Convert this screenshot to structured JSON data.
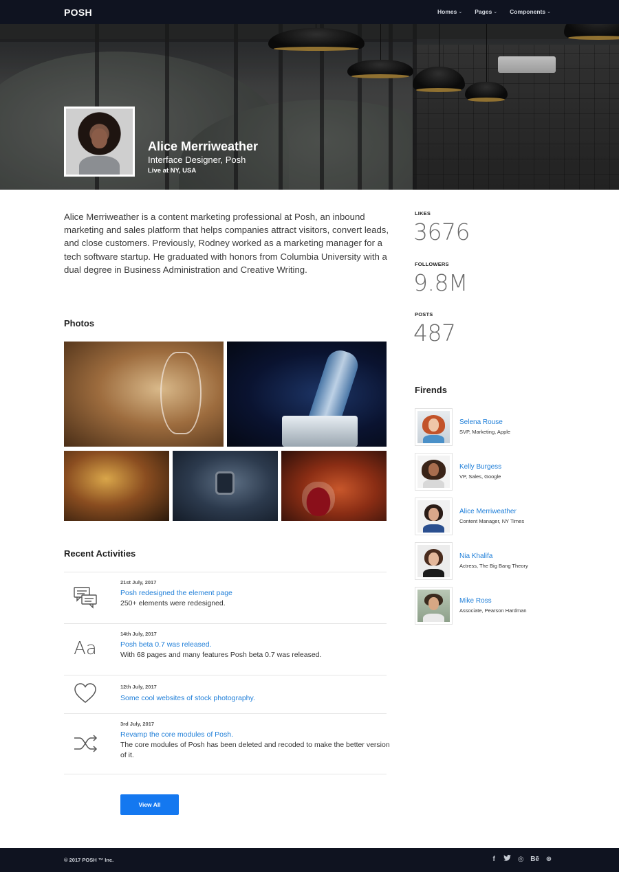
{
  "brand": {
    "logo": "POSH"
  },
  "nav": [
    {
      "label": "Homes"
    },
    {
      "label": "Pages"
    },
    {
      "label": "Components"
    }
  ],
  "profile": {
    "name": "Alice Merriweather",
    "role": "Interface Designer, Posh",
    "location": "Live at NY, USA",
    "bio": "Alice Merriweather is a content marketing professional at Posh, an inbound marketing and sales platform that helps companies attract visitors, convert leads, and close customers. Previously, Rodney worked as a marketing manager for a tech software startup. He graduated with honors from Columbia University with a dual degree in Business Administration and Creative Writing."
  },
  "sections": {
    "photos_title": "Photos",
    "activities_title": "Recent Activities",
    "friends_title": "Firends"
  },
  "stats": [
    {
      "label": "LIKES",
      "value": "3676"
    },
    {
      "label": "FOLLOWERS",
      "value": "9.8M"
    },
    {
      "label": "POSTS",
      "value": "487"
    }
  ],
  "activities": [
    {
      "icon": "chat-icon",
      "date": "21st July, 2017",
      "title": "Posh redesigned the element page",
      "desc": "250+ elements were redesigned."
    },
    {
      "icon": "typography-icon",
      "icon_text": "Aa",
      "date": "14th July, 2017",
      "title": "Posh beta 0.7 was released.",
      "desc": "With 68 pages and many features Posh beta 0.7 was released."
    },
    {
      "icon": "heart-icon",
      "date": "12th July, 2017",
      "title": "Some cool websites of stock photography.",
      "desc": ""
    },
    {
      "icon": "shuffle-icon",
      "date": "3rd July, 2017",
      "title": "Revamp the core modules of Posh.",
      "desc": "The core modules of Posh has been deleted and recoded to make the better version of it."
    }
  ],
  "view_all": "View All",
  "friends": [
    {
      "name": "Selena Rouse",
      "role": "SVP, Marketing, Apple"
    },
    {
      "name": "Kelly Burgess",
      "role": "VP, Sales, Google"
    },
    {
      "name": "Alice Merriweather",
      "role": "Content Manager, NY Times"
    },
    {
      "name": "Nia Khalifa",
      "role": "Actress, The Big Bang Theory"
    },
    {
      "name": "Mike Ross",
      "role": "Associate, Pearson Hardman"
    }
  ],
  "footer": {
    "copyright": "© 2017 POSH ™ Inc.",
    "social": [
      {
        "icon": "facebook-icon",
        "glyph": "f"
      },
      {
        "icon": "twitter-icon",
        "glyph": "🐦"
      },
      {
        "icon": "instagram-icon",
        "glyph": "◎"
      },
      {
        "icon": "behance-icon",
        "glyph": "Bē"
      },
      {
        "icon": "dribbble-icon",
        "glyph": "⊛"
      }
    ]
  },
  "colors": {
    "navbar": "#0f1320",
    "link": "#1e7ed8",
    "button": "#1478f0"
  }
}
